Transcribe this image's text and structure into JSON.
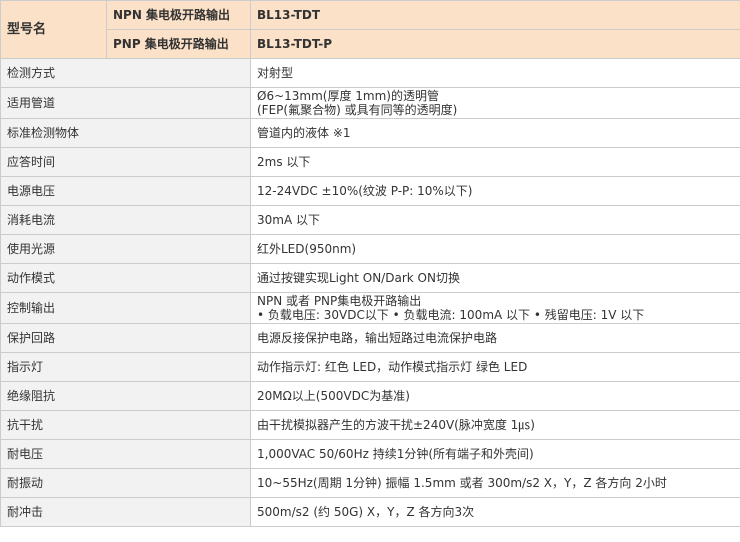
{
  "header": {
    "model_label": "型号名",
    "rows": [
      {
        "output_type": "NPN 集电极开路输出",
        "model": "BL13-TDT"
      },
      {
        "output_type": "PNP 集电极开路输出",
        "model": "BL13-TDT-P"
      }
    ]
  },
  "specs": [
    {
      "label": "检测方式",
      "value": "对射型"
    },
    {
      "label": "适用管道",
      "value_line1": "Ø6~13mm(厚度 1mm)的透明管",
      "value_line2": "(FEP(氟聚合物) 或具有同等的透明度)"
    },
    {
      "label": "标准检测物体",
      "value": "管道内的液体 ※1"
    },
    {
      "label": "应答时间",
      "value": "2ms 以下"
    },
    {
      "label": "电源电压",
      "value": "12-24VDC ±10%(纹波 P-P: 10%以下)"
    },
    {
      "label": "消耗电流",
      "value": "30mA 以下"
    },
    {
      "label": "使用光源",
      "value": "红外LED(950nm)"
    },
    {
      "label": "动作模式",
      "value": "通过按键实现Light ON/Dark ON切换"
    },
    {
      "label": "控制输出",
      "value_line1": "NPN 或者 PNP集电极开路输出",
      "value_line2": "• 负载电压: 30VDC以下 • 负载电流: 100mA 以下 • 残留电压: 1V 以下"
    },
    {
      "label": "保护回路",
      "value": "电源反接保护电路，输出短路过电流保护电路"
    },
    {
      "label": "指示灯",
      "value": "动作指示灯: 红色 LED，动作模式指示灯 绿色 LED"
    },
    {
      "label": "绝缘阻抗",
      "value": "20MΩ以上(500VDC为基准)"
    },
    {
      "label": "抗干扰",
      "value": "由干扰模拟器产生的方波干扰±240V(脉冲宽度 1㎲)"
    },
    {
      "label": "耐电压",
      "value": "1,000VAC 50/60Hz 持续1分钟(所有端子和外壳间)"
    },
    {
      "label": "耐振动",
      "value": "10~55Hz(周期 1分钟) 振幅 1.5mm 或者 300m/s2 X，Y，Z 各方向 2小时"
    },
    {
      "label": "耐冲击",
      "value": "500m/s2 (约 50G) X，Y，Z 各方向3次"
    }
  ]
}
